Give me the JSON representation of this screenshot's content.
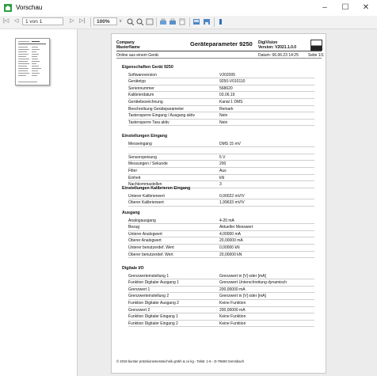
{
  "window": {
    "title": "Vorschau",
    "controls": {
      "minimize": "–",
      "maximize": "☐",
      "close": "✕"
    }
  },
  "toolbar": {
    "first": "|◁",
    "prev": "◁",
    "page_field": "1 von 1",
    "next": "▷",
    "last": "▷|",
    "zoom": "100%",
    "zoom_arrow": "∨"
  },
  "report": {
    "company": "Company",
    "master": "MasterName",
    "title": "Geräteparameter 9250",
    "software_label": "DigiVision",
    "version": "Version: V2021.1.0.0",
    "online": "Online aus einem Gerät.",
    "date": "Datum: 06.06.23 14:25",
    "page": "Seite 1/1",
    "footer": "© 2019 burster präzisionsmesstechnik gmbh & co kg - Talstr. 1-5 - D-76593 Gernsbach",
    "sections": [
      {
        "title": "Eigenschaften Gerät 9250",
        "rows": [
          [
            "Softwareversion",
            "V202005"
          ],
          [
            "Gerätetyp",
            "9250-V010110"
          ],
          [
            "Seriennummer",
            "568620"
          ],
          [
            "Kalibrierdatum",
            "03.06.19"
          ],
          [
            "Gerätebezeichnung",
            "Kanal 1 DMS"
          ],
          [
            "Beschreibung Geräteparameter",
            "Remark"
          ],
          [
            "Tastensperre Eingang / Ausgang aktiv",
            "Nein"
          ],
          [
            "Tastensperre Tara aktiv",
            "Nein"
          ]
        ]
      },
      {
        "title": "Einstellungen Eingang",
        "rows": [
          [
            "Messeingang",
            "DMS 15 mV"
          ],
          [
            "",
            ""
          ],
          [
            "Sensorspeisung",
            "5 V"
          ],
          [
            "Messungen / Sekunde",
            "200"
          ],
          [
            "Filter",
            "Aus"
          ],
          [
            "Einheit",
            "kN"
          ],
          [
            "Nachkommastellen",
            "3"
          ]
        ]
      },
      {
        "title": "Einstellungen Kalibrieren Eingang",
        "rows": [
          [
            "Unterer Kalibrierwert",
            "0,00022 mV/V"
          ],
          [
            "Oberer Kalibrierwert",
            "1,99633 mV/V"
          ]
        ]
      },
      {
        "title": "Ausgang",
        "rows": [
          [
            "Analogausgang",
            "4-20 mA"
          ],
          [
            "Bezug",
            "Aktueller Messwert"
          ],
          [
            "Unterer Analogwert",
            "4,00000 mA"
          ],
          [
            "Oberer Analogwert",
            "20,00000 mA"
          ],
          [
            "Unterer benutzerdef. Wert",
            "0,00000 kN"
          ],
          [
            "Oberer benutzerdef. Wert",
            "20,00000 kN"
          ]
        ]
      },
      {
        "title": "Digitale I/O",
        "rows": [
          [
            "Grenzwerteinstellung 1",
            "Grenzwert in [V] oder [mA]"
          ],
          [
            "Funktion Digitaler Ausgang 1",
            "Grenzwert Unterschreitung dynamisch"
          ],
          [
            "Grenzwert 1",
            "200,00000 mA"
          ],
          [
            "Grenzwerteinstellung 2",
            "Grenzwert in [V] oder [mA]"
          ],
          [
            "Funktion Digitaler Ausgang 2",
            "Keine Funktion"
          ],
          [
            "Grenzwert 2",
            "200,00000 mA"
          ],
          [
            "Funktion Digitaler Eingang 1",
            "Keine Funktion"
          ],
          [
            "Funktion Digitaler Eingang 2",
            "Keine Funktion"
          ]
        ]
      }
    ]
  }
}
